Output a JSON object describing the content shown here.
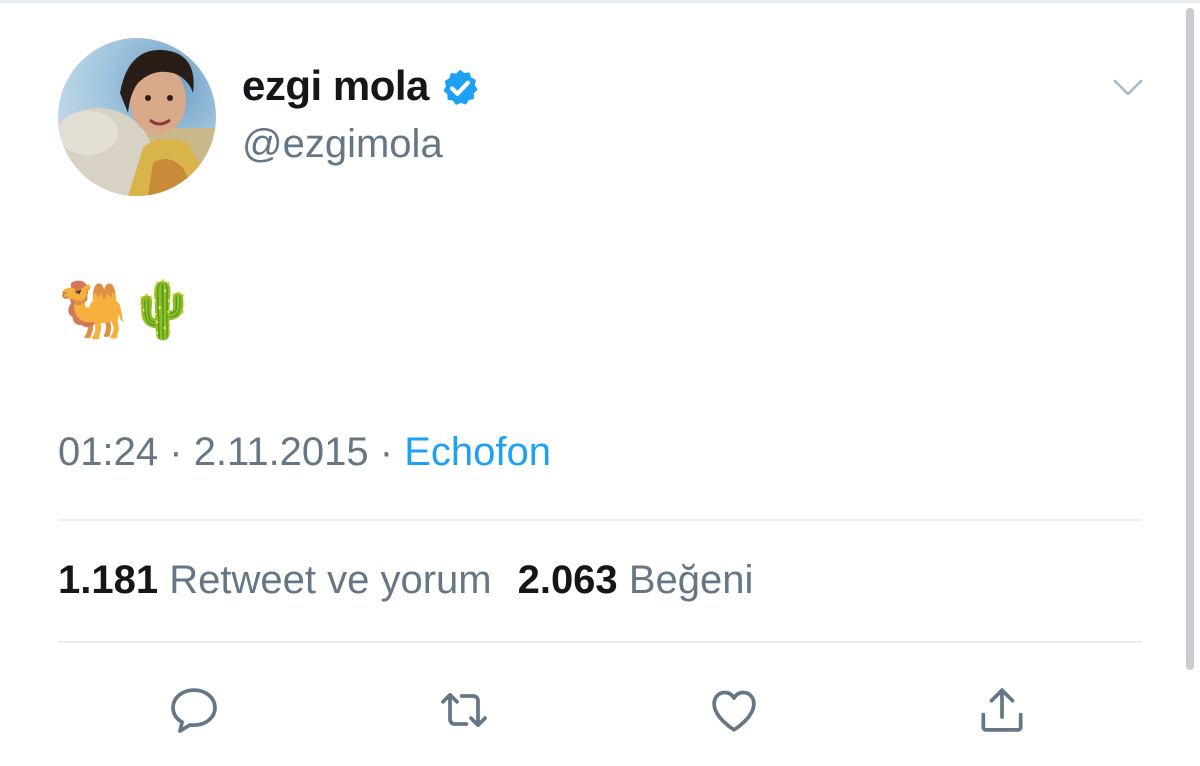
{
  "tweet": {
    "display_name": "ezgi mola",
    "handle": "@ezgimola",
    "verified": true,
    "text": "🐫🌵",
    "time": "01:24",
    "separator": "·",
    "date": "2.11.2015",
    "source": "Echofon"
  },
  "stats": {
    "retweets_count": "1.181",
    "retweets_label": "Retweet ve yorum",
    "likes_count": "2.063",
    "likes_label": "Beğeni"
  },
  "icons": {
    "reply": "reply-icon",
    "retweet": "retweet-icon",
    "like": "heart-icon",
    "share": "share-icon",
    "more": "chevron-down-icon",
    "verified": "verified-badge-icon"
  },
  "colors": {
    "accent": "#1da1f2",
    "muted_text": "#657786",
    "primary_text": "#14171a",
    "divider": "#e6ecf0"
  }
}
